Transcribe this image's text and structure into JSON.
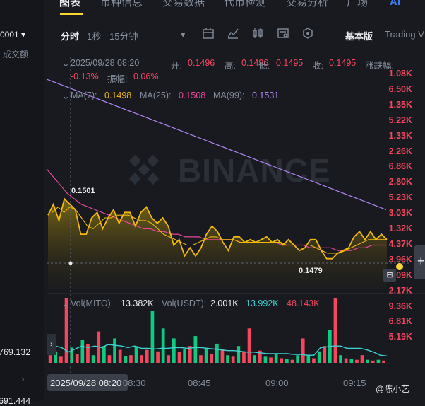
{
  "order_book": {
    "pair_label": "0001",
    "volume_header": "成交额",
    "rows": [
      "1.08K",
      "6.50K",
      "1.35K",
      "5.22K",
      "1.33K",
      "2.26K",
      "6.86K",
      "2.80K",
      "5.23K",
      "3.03K",
      "1.32K",
      "4.37K",
      "3.96K",
      "4.09K",
      "2.17K",
      "9.36K",
      "6.81K",
      "5.19K",
      "769.132"
    ],
    "bottom_value": "691.444"
  },
  "top_tabs": [
    "图表",
    "币种信息",
    "交易数据",
    "代币检测",
    "交易分析",
    "广场"
  ],
  "active_tab": "图表",
  "toolbar": {
    "time_share": "分时",
    "one_sec": "1秒",
    "fifteen_min": "15分钟",
    "basic": "基本版",
    "trading_view": "Trading V"
  },
  "ohlc": {
    "date": "2025/09/28 08:20",
    "open_label": "开:",
    "open": "0.1496",
    "high_label": "高:",
    "high": "0.1496",
    "low_label": "低:",
    "low": "0.1495",
    "close_label": "收:",
    "close": "0.1495",
    "change_label": "涨跌幅:",
    "change": "-0.13%",
    "amp_label": "振幅:",
    "amp": "0.06%"
  },
  "ma": {
    "ma7_label": "MA(7):",
    "ma7": "0.1498",
    "ma25_label": "MA(25):",
    "ma25": "0.1508",
    "ma99_label": "MA(99):",
    "ma99": "0.1531"
  },
  "vol": {
    "mito_label": "Vol(MITO):",
    "mito": "13.382K",
    "usdt_label": "Vol(USDT):",
    "usdt": "2.001K",
    "ma1": "13.992K",
    "ma2": "48.143K"
  },
  "watermark": "BINANCE",
  "credit": "@陈小艺",
  "cursor_date": "2025/09/28 08:20",
  "colors": {
    "up": "#0ecb81",
    "down": "#f6465d",
    "ma7": "#f0b90b",
    "ma25": "#e5479a",
    "ma99": "#b187f5",
    "vol_ma": "#3ed4d4"
  },
  "chart_data": {
    "type": "line",
    "x_ticks": [
      "08:30",
      "08:45",
      "09:00",
      "09:15"
    ],
    "price_high_label": "0.1501",
    "price_low_label": "0.1479",
    "price": [
      0.1495,
      0.1499,
      0.1493,
      0.1501,
      0.1499,
      0.1497,
      0.1488,
      0.1488,
      0.1494,
      0.1496,
      0.149,
      0.1494,
      0.1497,
      0.1492,
      0.1496,
      0.1496,
      0.1491,
      0.1496,
      0.1498,
      0.1494,
      0.1492,
      0.1494,
      0.1491,
      0.1484,
      0.1486,
      0.148,
      0.1483,
      0.148,
      0.1483,
      0.1488,
      0.1491,
      0.1489,
      0.1485,
      0.1482,
      0.1487,
      0.1487,
      0.1485,
      0.1486,
      0.1485,
      0.1486,
      0.1487,
      0.1485,
      0.1486,
      0.1484,
      0.1486,
      0.1484,
      0.1482,
      0.1483,
      0.1486,
      0.1486,
      0.1482,
      0.1479,
      0.1479,
      0.1481,
      0.1482,
      0.1483,
      0.1487,
      0.1489,
      0.1486,
      0.1489,
      0.1486,
      0.1488,
      0.1486
    ],
    "ma7": [
      0.1496,
      0.1498,
      0.1496,
      0.1498,
      0.1497,
      0.1494,
      0.1491,
      0.149,
      0.1492,
      0.1494,
      0.1494,
      0.1495,
      0.1495,
      0.1495,
      0.1494,
      0.1493,
      0.1493,
      0.1492,
      0.149,
      0.1488,
      0.1487,
      0.1486,
      0.1485,
      0.1484,
      0.1484,
      0.1485,
      0.1486,
      0.1487,
      0.1487,
      0.1486,
      0.1486,
      0.1486,
      0.1485,
      0.1485,
      0.1485,
      0.1485,
      0.1485,
      0.1485,
      0.1485,
      0.1485,
      0.1484,
      0.1484,
      0.1484,
      0.1484,
      0.1484,
      0.1483,
      0.1482,
      0.1481,
      0.1481,
      0.1481,
      0.1482,
      0.1483,
      0.1484,
      0.1485,
      0.1486,
      0.1486,
      0.1486,
      0.1486
    ],
    "ma25": [
      0.1512,
      0.1509,
      0.1506,
      0.1503,
      0.1501,
      0.1499,
      0.1498,
      0.1497,
      0.1496,
      0.1495,
      0.1494,
      0.1493,
      0.1492,
      0.1491,
      0.149,
      0.149,
      0.1489,
      0.1489,
      0.1488,
      0.1488,
      0.1487,
      0.1487,
      0.1487,
      0.1486,
      0.1486,
      0.1486,
      0.1486,
      0.1486,
      0.1485,
      0.1485,
      0.1485,
      0.1485,
      0.1485,
      0.1485,
      0.1484,
      0.1484,
      0.1484,
      0.1484,
      0.1483,
      0.1483,
      0.1483,
      0.1483,
      0.1482,
      0.1482,
      0.1482,
      0.1483,
      0.1483,
      0.1484,
      0.1484,
      0.1484
    ],
    "ma99": [
      0.1545,
      0.1543,
      0.1541,
      0.1539,
      0.1537,
      0.1535,
      0.1533,
      0.1531,
      0.1529,
      0.1527,
      0.1525,
      0.1523,
      0.1521,
      0.1519,
      0.1517,
      0.1515,
      0.1513,
      0.1511,
      0.1509,
      0.1507,
      0.1505,
      0.1503,
      0.1501,
      0.1499,
      0.1497
    ],
    "volume": [
      {
        "v": 1.0,
        "up": false
      },
      {
        "v": 1.5,
        "up": true
      },
      {
        "v": 0.8,
        "up": false
      },
      {
        "v": 8.5,
        "up": false
      },
      {
        "v": 2.0,
        "up": true
      },
      {
        "v": 1.2,
        "up": false
      },
      {
        "v": 3.0,
        "up": true
      },
      {
        "v": 2.4,
        "up": false
      },
      {
        "v": 1.0,
        "up": true
      },
      {
        "v": 4.1,
        "up": false
      },
      {
        "v": 2.2,
        "up": true
      },
      {
        "v": 1.0,
        "up": false
      },
      {
        "v": 3.2,
        "up": true
      },
      {
        "v": 1.7,
        "up": false
      },
      {
        "v": 0.9,
        "up": true
      },
      {
        "v": 1.0,
        "up": false
      },
      {
        "v": 2.2,
        "up": true
      },
      {
        "v": 1.0,
        "up": false
      },
      {
        "v": 1.7,
        "up": false
      },
      {
        "v": 6.8,
        "up": true
      },
      {
        "v": 1.5,
        "up": false
      },
      {
        "v": 4.5,
        "up": true
      },
      {
        "v": 1.0,
        "up": false
      },
      {
        "v": 3.2,
        "up": true
      },
      {
        "v": 1.4,
        "up": false
      },
      {
        "v": 1.8,
        "up": true
      },
      {
        "v": 2.2,
        "up": false
      },
      {
        "v": 3.5,
        "up": true
      },
      {
        "v": 1.0,
        "up": false
      },
      {
        "v": 1.9,
        "up": true
      },
      {
        "v": 1.2,
        "up": false
      },
      {
        "v": 2.5,
        "up": true
      },
      {
        "v": 1.8,
        "up": false
      },
      {
        "v": 1.0,
        "up": true
      },
      {
        "v": 0.8,
        "up": false
      },
      {
        "v": 2.2,
        "up": true
      },
      {
        "v": 1.4,
        "up": false
      },
      {
        "v": 4.5,
        "up": false
      },
      {
        "v": 1.0,
        "up": true
      },
      {
        "v": 1.6,
        "up": false
      },
      {
        "v": 0.8,
        "up": true
      },
      {
        "v": 0.7,
        "up": false
      },
      {
        "v": 1.2,
        "up": true
      },
      {
        "v": 0.6,
        "up": false
      },
      {
        "v": 0.5,
        "up": true
      },
      {
        "v": 0.4,
        "up": false
      },
      {
        "v": 1.0,
        "up": true
      },
      {
        "v": 3.2,
        "up": false
      },
      {
        "v": 1.0,
        "up": true
      },
      {
        "v": 0.6,
        "up": false
      },
      {
        "v": 1.5,
        "up": true
      },
      {
        "v": 2.2,
        "up": false
      },
      {
        "v": 4.3,
        "up": true
      },
      {
        "v": 8.5,
        "up": false
      },
      {
        "v": 1.0,
        "up": true
      },
      {
        "v": 0.6,
        "up": false
      },
      {
        "v": 0.5,
        "up": true
      },
      {
        "v": 0.4,
        "up": false
      },
      {
        "v": 1.0,
        "up": false
      },
      {
        "v": 0.4,
        "up": true
      },
      {
        "v": 0.3,
        "up": false
      },
      {
        "v": 0.4,
        "up": true
      },
      {
        "v": 0.3,
        "up": false
      }
    ],
    "volume_ma": [
      2.2,
      2.0,
      1.4,
      1.8,
      2.2,
      2.0,
      2.2,
      2.0,
      2.4,
      2.3,
      2.2,
      2.0,
      2.2,
      1.9,
      1.9,
      1.8,
      1.9,
      1.9,
      2.0,
      2.0,
      1.9,
      2.0,
      2.0,
      1.9,
      1.8,
      1.7,
      1.6,
      1.6,
      1.5,
      1.4,
      1.4,
      1.3,
      1.2,
      1.2,
      1.2,
      1.2,
      1.1,
      1.1,
      1.0,
      1.0,
      2.0,
      2.1,
      2.2,
      2.2,
      1.9,
      1.9,
      1.9,
      1.7,
      1.4,
      1.0,
      0.9
    ]
  }
}
